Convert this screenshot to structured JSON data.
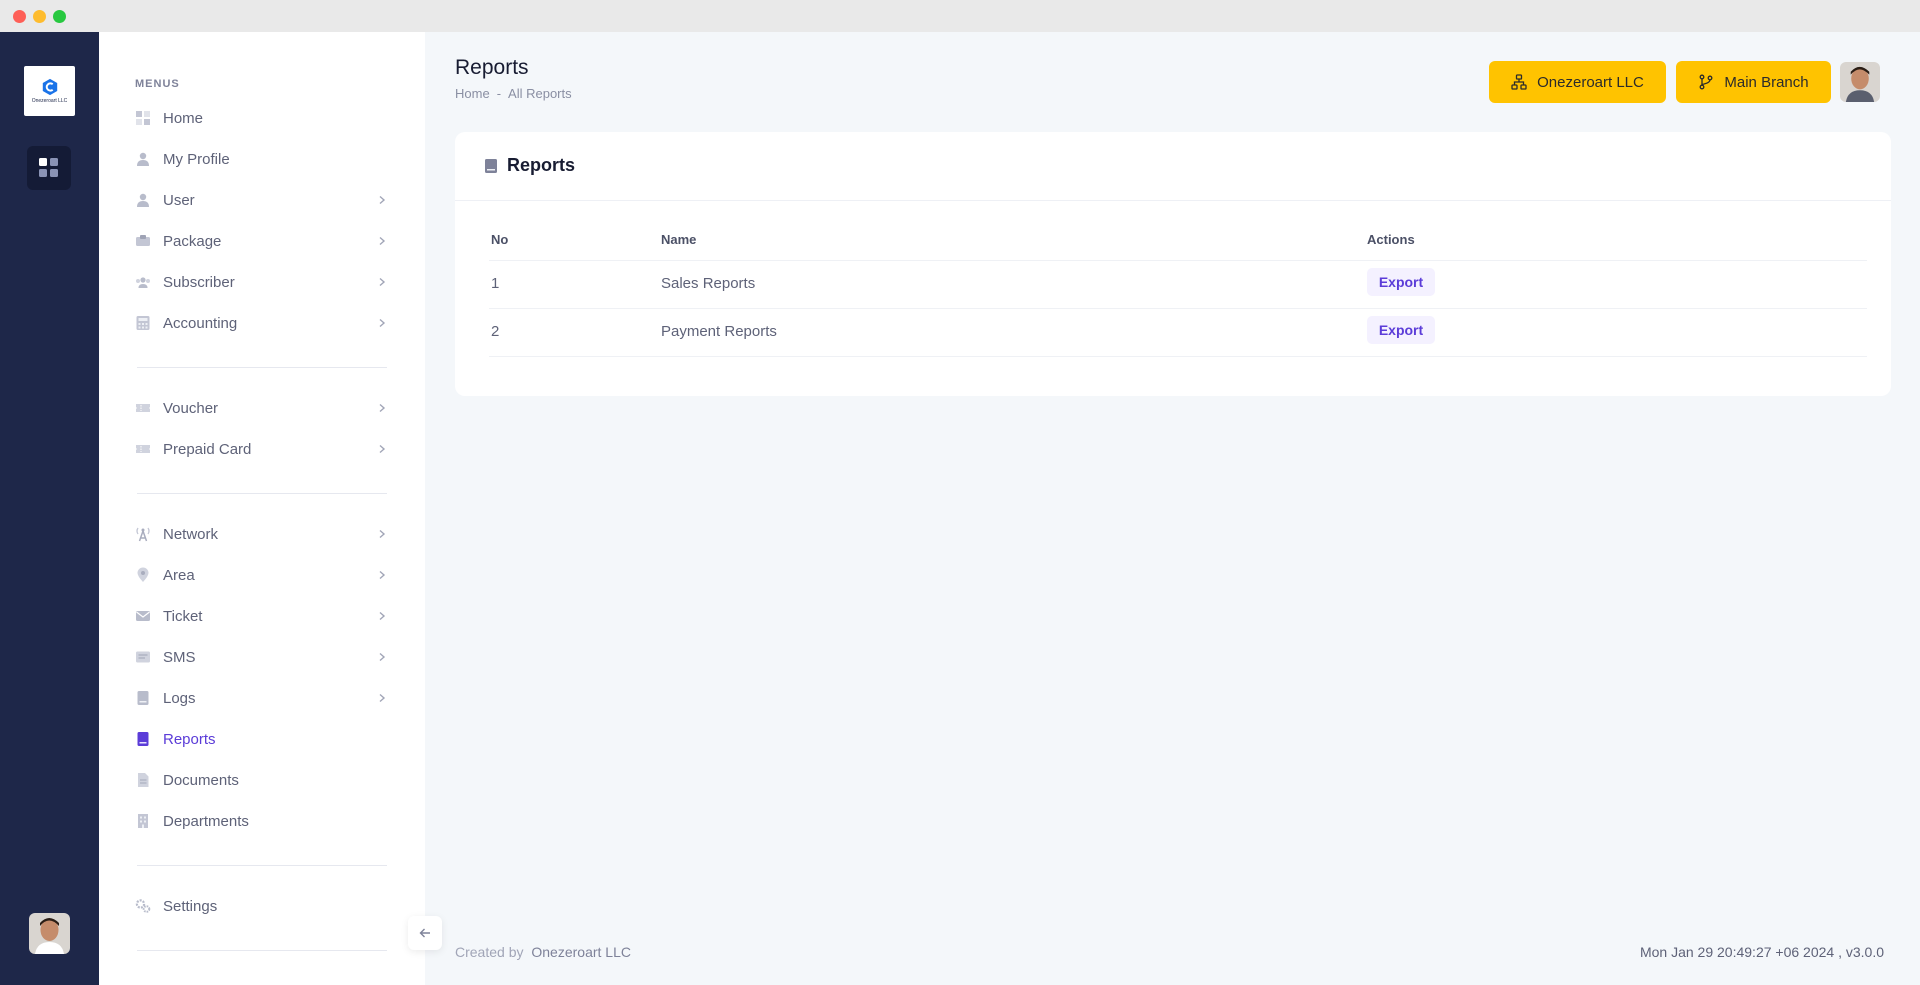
{
  "brand": {
    "logo_text": "Onezeroart LLC"
  },
  "sidebar": {
    "menus_label": "MENUS",
    "items": [
      {
        "label": "Home",
        "icon": "home-grid-icon"
      },
      {
        "label": "My Profile",
        "icon": "user-icon"
      },
      {
        "label": "User",
        "icon": "user-icon"
      },
      {
        "label": "Package",
        "icon": "package-icon"
      },
      {
        "label": "Subscriber",
        "icon": "users-icon"
      },
      {
        "label": "Accounting",
        "icon": "calculator-icon"
      },
      {
        "label": "Voucher",
        "icon": "ticket-icon"
      },
      {
        "label": "Prepaid Card",
        "icon": "ticket-icon"
      },
      {
        "label": "Network",
        "icon": "antenna-icon"
      },
      {
        "label": "Area",
        "icon": "map-pin-icon"
      },
      {
        "label": "Ticket",
        "icon": "envelope-icon"
      },
      {
        "label": "SMS",
        "icon": "message-icon"
      },
      {
        "label": "Logs",
        "icon": "book-icon"
      },
      {
        "label": "Reports",
        "icon": "book-icon"
      },
      {
        "label": "Documents",
        "icon": "document-icon"
      },
      {
        "label": "Departments",
        "icon": "building-icon"
      },
      {
        "label": "Settings",
        "icon": "gears-icon"
      }
    ]
  },
  "header": {
    "title": "Reports",
    "breadcrumb": {
      "home": "Home",
      "separator": "-",
      "current": "All Reports"
    },
    "org_button": "Onezeroart LLC",
    "branch_button": "Main Branch"
  },
  "card": {
    "title": "Reports",
    "columns": {
      "no": "No",
      "name": "Name",
      "actions": "Actions"
    },
    "rows": [
      {
        "no": "1",
        "name": "Sales Reports",
        "action": "Export"
      },
      {
        "no": "2",
        "name": "Payment Reports",
        "action": "Export"
      }
    ]
  },
  "footer": {
    "created_by": "Created by",
    "company": "Onezeroart LLC",
    "timestamp": "Mon Jan 29 20:49:27 +06 2024 ,",
    "version": "v3.0.0"
  },
  "colors": {
    "rail": "#1e2749",
    "accent": "#5b3cd8",
    "button": "#ffc300"
  }
}
